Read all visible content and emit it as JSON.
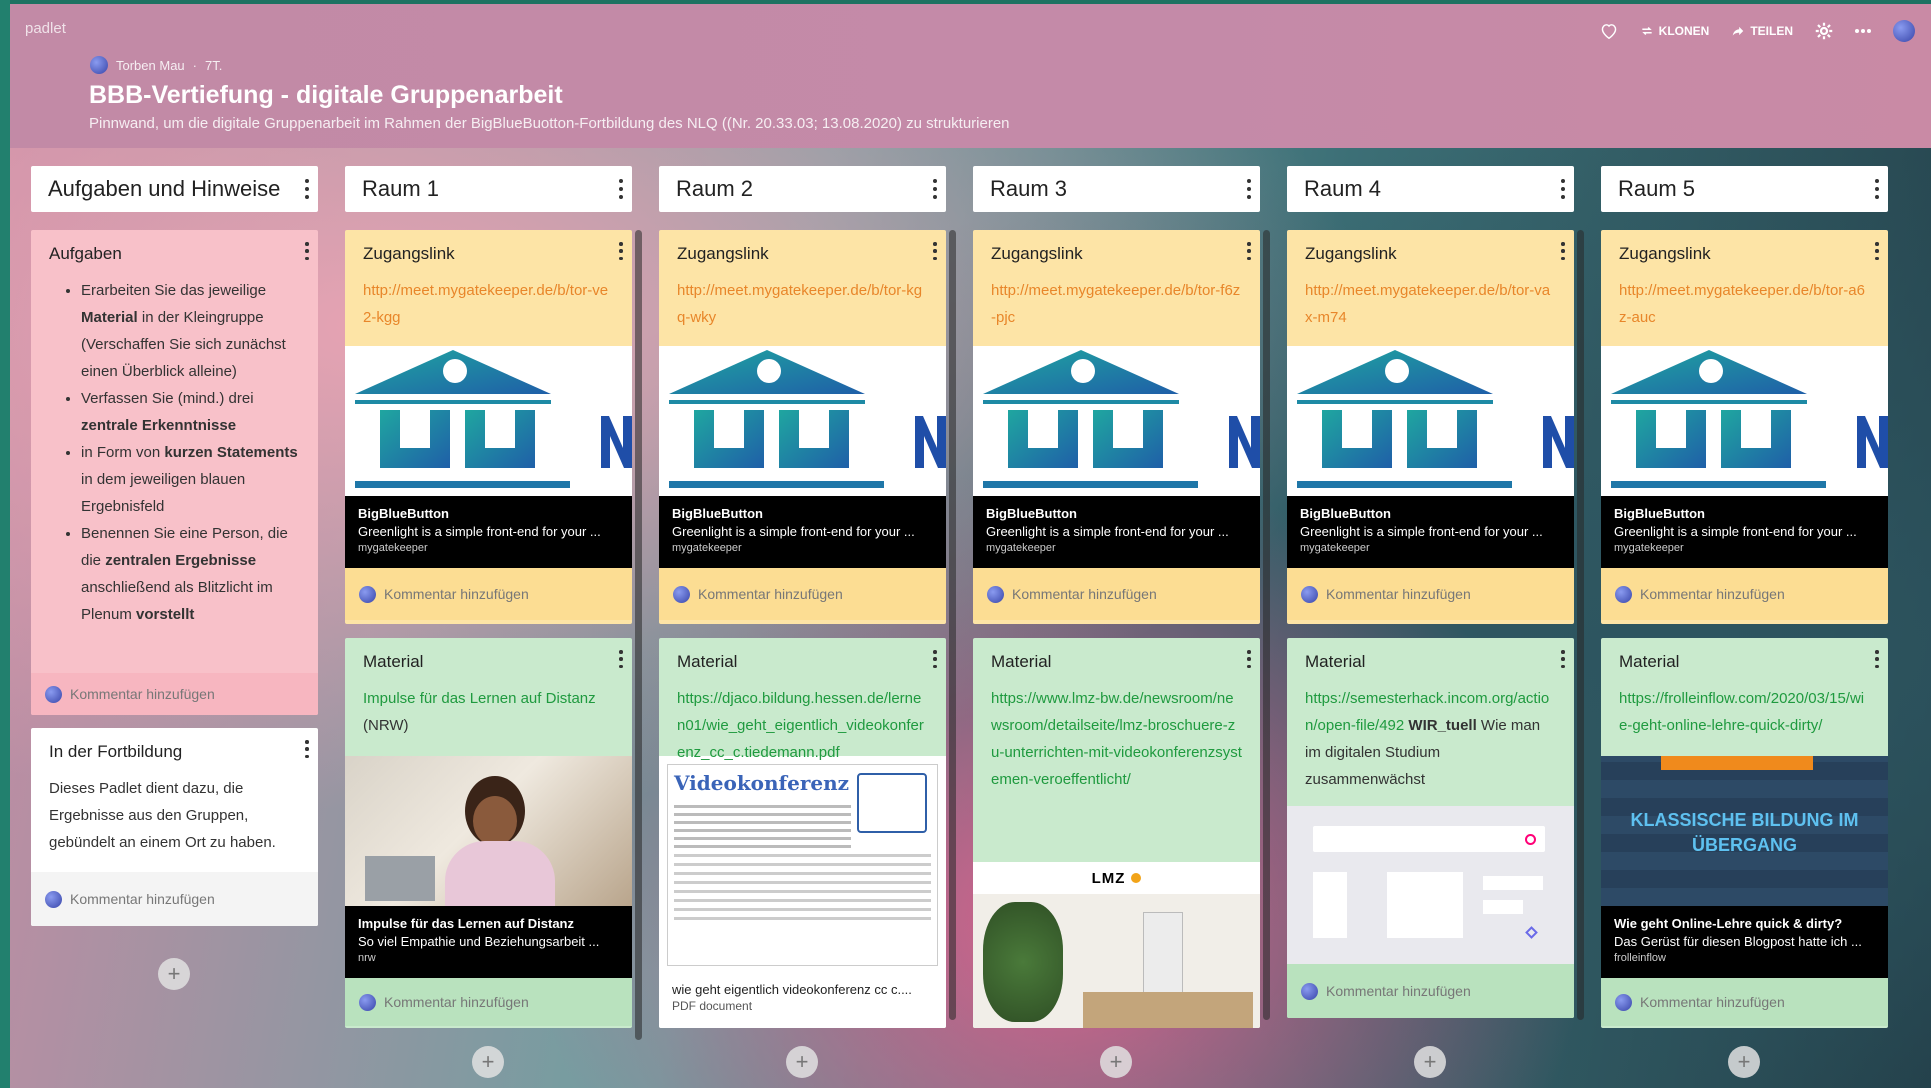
{
  "app": {
    "brand": "padlet",
    "actions": {
      "clone": "KLONEN",
      "share": "TEILEN"
    }
  },
  "board": {
    "author": "Torben Mau",
    "age": "7T.",
    "title": "BBB-Vertiefung - digitale Gruppenarbeit",
    "subtitle": "Pinnwand, um die digitale Gruppenarbeit im Rahmen der BigBlueBuotton-Fortbildung des NLQ ((Nr. 20.33.03; 13.08.2020) zu strukturieren"
  },
  "comment_placeholder": "Kommentar hinzufügen",
  "col0": {
    "title": "Aufgaben und Hinweise",
    "card1": {
      "title": "Aufgaben",
      "items": [
        {
          "a": "Erarbeiten Sie das jeweilige ",
          "b": "Material",
          "c": " in der Kleingruppe (Verschaffen Sie sich zunächst einen Überblick alleine)"
        },
        {
          "a": "Verfassen Sie (mind.) drei ",
          "b": "zentrale Erkenntnisse",
          "c": ""
        },
        {
          "a": "in Form von ",
          "b": "kurzen Statements",
          "c": " in dem jeweiligen blauen Ergebnisfeld"
        },
        {
          "a": "Benennen Sie eine Person, die die ",
          "b": "zentralen Ergebnisse",
          "c": " anschließend als Blitzlicht im Plenum ",
          "d": "vorstellt"
        }
      ]
    },
    "card2": {
      "title": "In der Fortbildung",
      "text": "Dieses Padlet dient dazu, die Ergebnisse aus den Gruppen, gebündelt an einem Ort zu haben."
    }
  },
  "rooms": [
    {
      "title": "Raum 1",
      "link_title": "Zugangslink",
      "link": "http://meet.mygatekeeper.de/b/tor-ve2-kgg",
      "preview": {
        "name": "BigBlueButton",
        "desc": "Greenlight is a simple front-end for your ...",
        "source": "mygatekeeper"
      },
      "material_title": "Material",
      "material_link": "Impulse für das Lernen auf Distanz",
      "material_text": " (NRW)",
      "material_preview": {
        "name": "Impulse für das Lernen auf Distanz",
        "desc": "So viel Empathie und Beziehungsarbeit ...",
        "source": "nrw"
      }
    },
    {
      "title": "Raum 2",
      "link_title": "Zugangslink",
      "link": "http://meet.mygatekeeper.de/b/tor-kgq-wky",
      "preview": {
        "name": "BigBlueButton",
        "desc": "Greenlight is a simple front-end for your ...",
        "source": "mygatekeeper"
      },
      "material_title": "Material",
      "material_link": "https://djaco.bildung.hessen.de/lernen01/wie_geht_eigentlich_videokonferenz_cc_c.tiedemann.pdf",
      "material_text": "",
      "material_preview": {
        "name": "wie geht eigentlich videokonferenz cc c....",
        "desc": "PDF document",
        "source": ""
      },
      "doc_heading": "Videokonferenz"
    },
    {
      "title": "Raum 3",
      "link_title": "Zugangslink",
      "link": "http://meet.mygatekeeper.de/b/tor-f6z-pjc",
      "preview": {
        "name": "BigBlueButton",
        "desc": "Greenlight is a simple front-end for your ...",
        "source": "mygatekeeper"
      },
      "material_title": "Material",
      "material_link": "https://www.lmz-bw.de/newsroom/newsroom/detailseite/lmz-broschuere-zu-unterrichten-mit-videokonferenzsystemen-veroeffentlicht/",
      "material_text": "",
      "logo_text": "LMZ"
    },
    {
      "title": "Raum 4",
      "link_title": "Zugangslink",
      "link": "http://meet.mygatekeeper.de/b/tor-vax-m74",
      "preview": {
        "name": "BigBlueButton",
        "desc": "Greenlight is a simple front-end for your ...",
        "source": "mygatekeeper"
      },
      "material_title": "Material",
      "material_link": "https://semesterhack.incom.org/action/open-file/492",
      "material_bold": " WIR_tuell",
      "material_text": " Wie man im digitalen Studium zusammenwächst"
    },
    {
      "title": "Raum 5",
      "link_title": "Zugangslink",
      "link": "http://meet.mygatekeeper.de/b/tor-a6z-auc",
      "preview": {
        "name": "BigBlueButton",
        "desc": "Greenlight is a simple front-end for your ...",
        "source": "mygatekeeper"
      },
      "material_title": "Material",
      "material_link": "https://frolleinflow.com/2020/03/15/wie-geht-online-lehre-quick-dirty/",
      "material_text": "",
      "material_preview": {
        "name": "Wie geht Online-Lehre quick &amp; dirty?",
        "desc": "Das Gerüst für diesen Blogpost hatte ich ...",
        "source": "frolleinflow"
      },
      "banner_text": "KLASSISCHE BILDUNG IM ÜBERGANG"
    }
  ]
}
